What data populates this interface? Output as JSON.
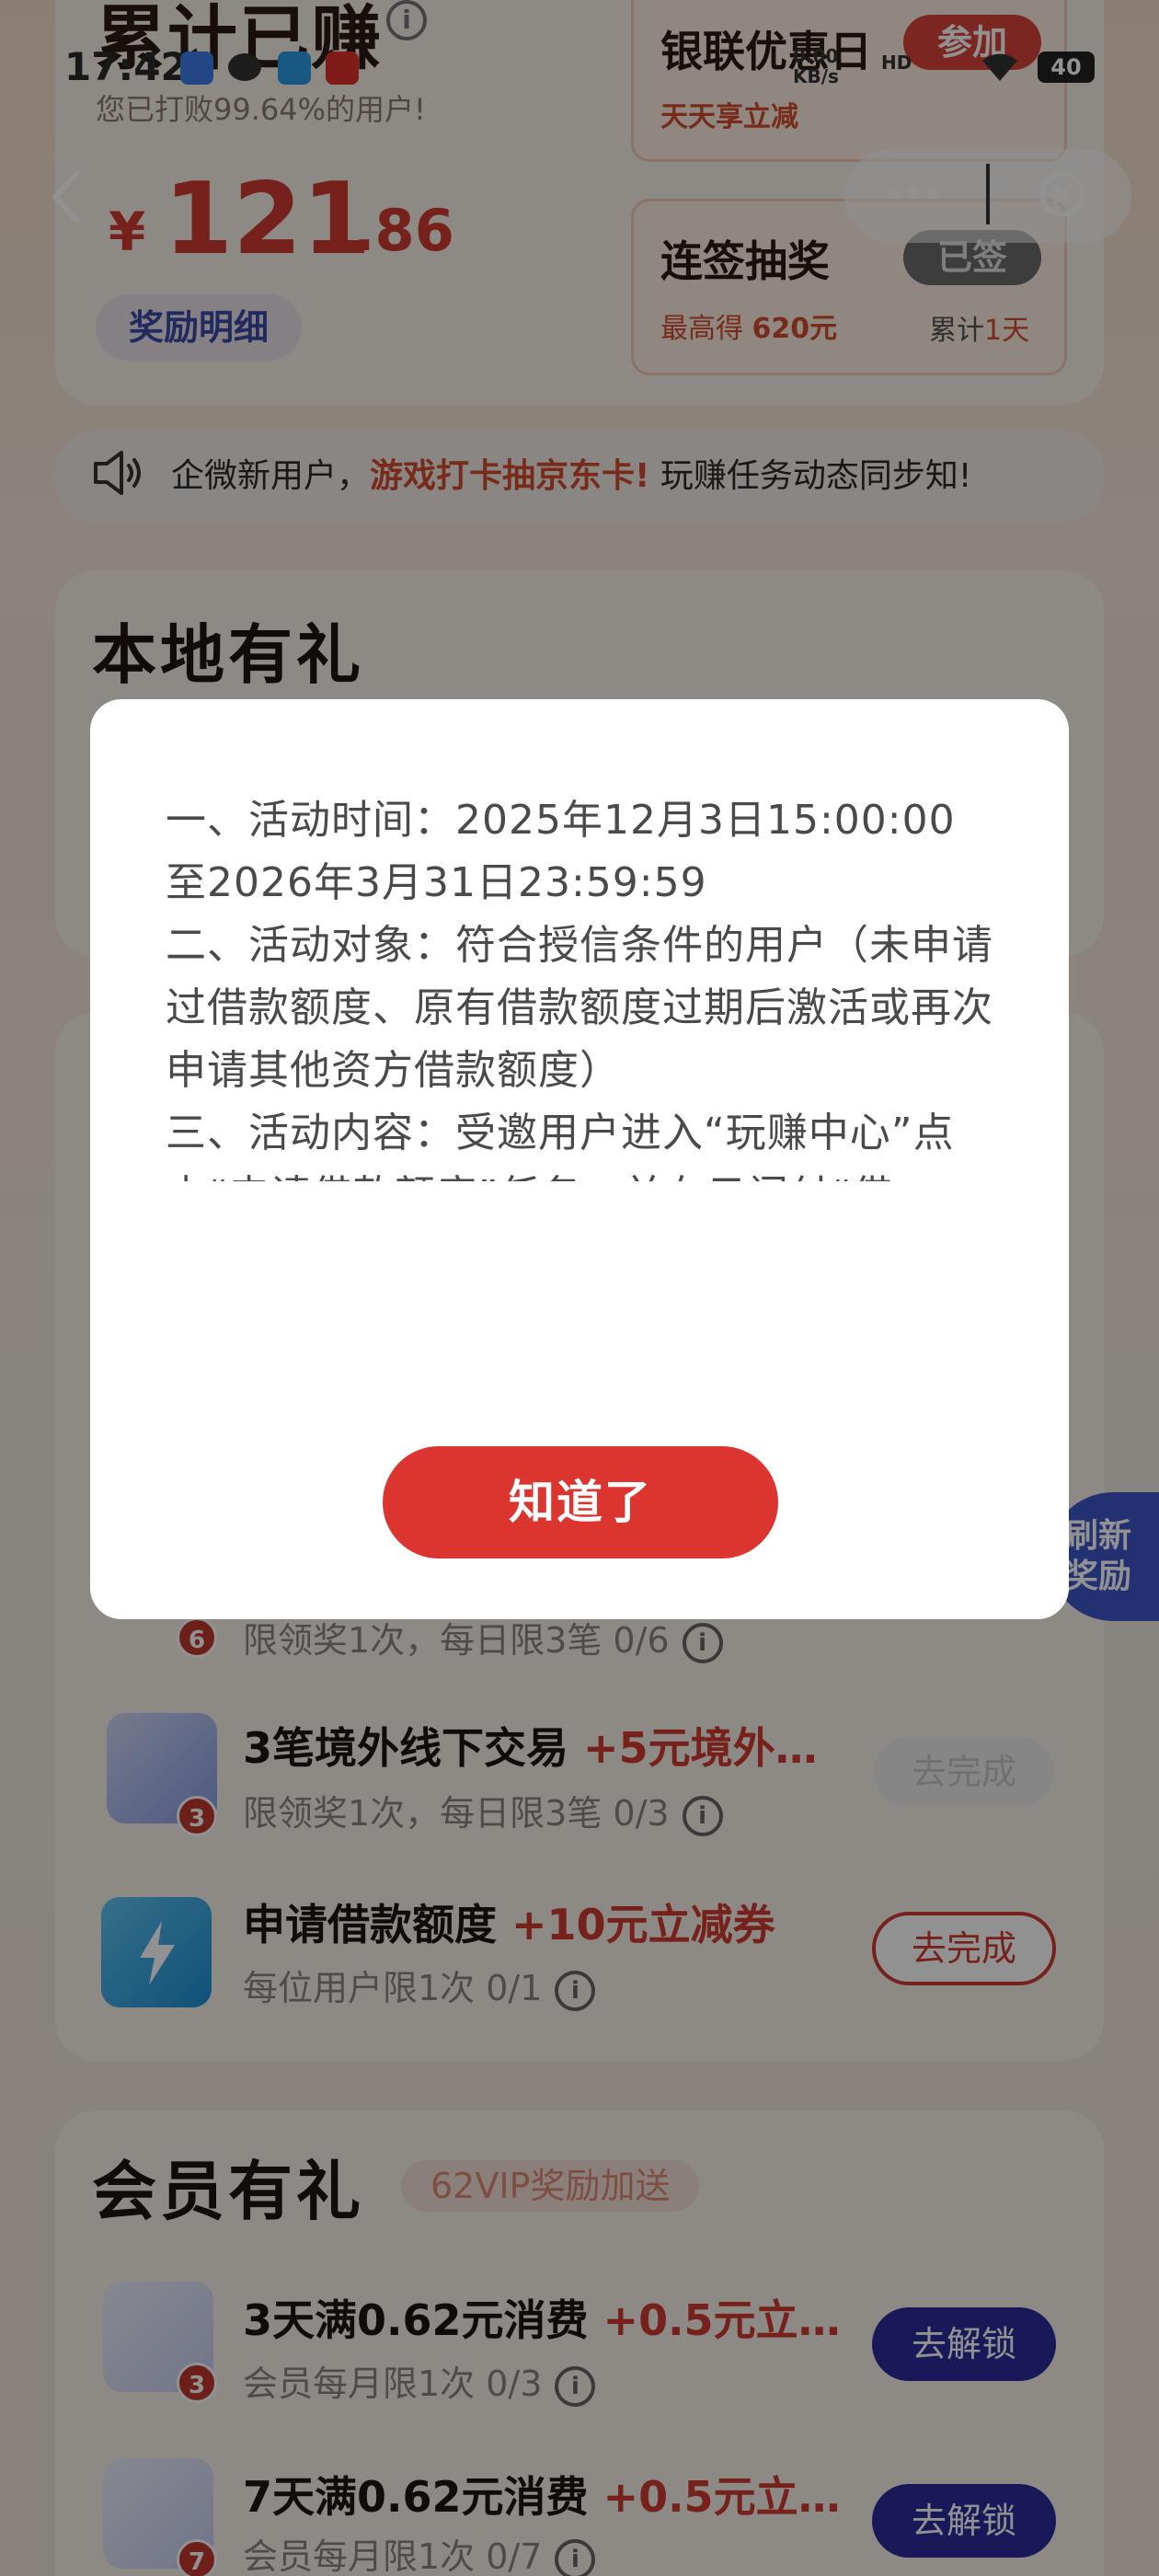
{
  "status_bar": {
    "time": "17:42",
    "network_speed": "0.00",
    "network_unit": "KB/s",
    "network_type": "HD",
    "battery": "40"
  },
  "header": {
    "earned_title": "累计已赚",
    "beat_text": "您已打败99.64%的用户!",
    "amount_currency": "¥",
    "amount_integer": "121",
    "amount_decimal": ".86",
    "reward_detail_label": "奖励明细"
  },
  "promo_unionpay": {
    "title": "银联优惠日",
    "subtitle": "天天享立减",
    "button": "参加"
  },
  "promo_checkin": {
    "title": "连签抽奖",
    "subtitle_prefix": "最高得 ",
    "subtitle_amount": "620元",
    "streak_prefix": "累计",
    "streak_value": "1天",
    "button": "已签"
  },
  "notice": {
    "text_prefix": "企微新用户，",
    "text_highlight": "游戏打卡抽京东卡!",
    "text_suffix": " 玩赚任务动态同步知!"
  },
  "local_section": {
    "title": "本地有礼"
  },
  "tasks_partial": {
    "row1_sub": "限领奖1次，每日限3笔  0/6",
    "row1_badge": "6",
    "refresh_bubble": "刷新奖励"
  },
  "tasks": [
    {
      "title": "3笔境外线下交易 ",
      "reward": "+5元境外…",
      "sub": "限领奖1次，每日限3笔  0/3",
      "badge": "3",
      "button": "去完成",
      "enabled": false
    },
    {
      "title": "申请借款额度 ",
      "reward": "+10元立减券",
      "sub": "每位用户限1次  0/1",
      "badge": "",
      "button": "去完成",
      "enabled": true
    }
  ],
  "member_section": {
    "title": "会员有礼",
    "badge": "62VIP奖励加送",
    "tasks": [
      {
        "title": "3天满0.62元消费 ",
        "reward": "+0.5元立…",
        "sub": "会员每月限1次  0/3",
        "badge": "3",
        "button": "去解锁"
      },
      {
        "title": "7天满0.62元消费 ",
        "reward": "+0.5元立…",
        "sub": "会员每月限1次  0/7",
        "badge": "7",
        "button": "去解锁"
      }
    ]
  },
  "modal": {
    "lines": [
      "一、活动时间：2025年12月3日15:00:00至2026年3月31日23:59:59",
      "二、活动对象：符合授信条件的用户（未申请过借款额度、原有借款额度过期后激活或再次申请其他资方借款额度）",
      "三、活动内容：受邀用户进入“玩赚中心”点击“申请借款额度”任务，并在云闪付“借款”平台，完成借款额度申请，即完成授信资料填写并成功提交至资方后，即可领取云闪付10元立减券。活动期间，单用户最多可"
    ],
    "ok_button": "知道了"
  }
}
